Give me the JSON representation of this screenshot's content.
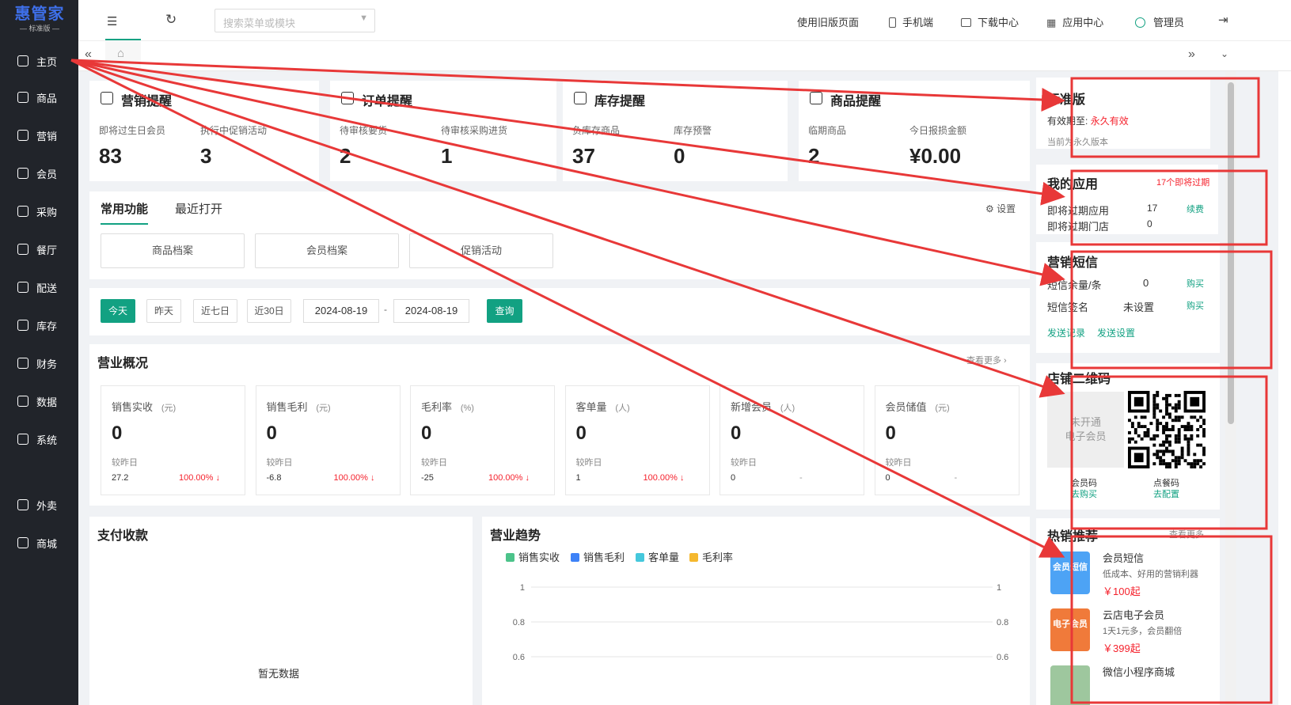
{
  "brand": {
    "name": "惠管家",
    "edition": "标准版"
  },
  "nav": [
    {
      "label": "主页",
      "icon": "home-icon"
    },
    {
      "label": "商品",
      "icon": "box-icon"
    },
    {
      "label": "营销",
      "icon": "chart-icon"
    },
    {
      "label": "会员",
      "icon": "diamond-icon"
    },
    {
      "label": "采购",
      "icon": "cart-icon"
    },
    {
      "label": "餐厅",
      "icon": "bell-icon"
    },
    {
      "label": "配送",
      "icon": "truck-icon"
    },
    {
      "label": "库存",
      "icon": "storage-icon"
    },
    {
      "label": "财务",
      "icon": "finance-icon"
    },
    {
      "label": "数据",
      "icon": "data-icon"
    },
    {
      "label": "系统",
      "icon": "settings-icon"
    },
    {
      "label": "外卖",
      "icon": "takeout-icon"
    },
    {
      "label": "商城",
      "icon": "mall-icon"
    }
  ],
  "topbar": {
    "search_placeholder": "搜索菜单或模块",
    "old_page": "使用旧版页面",
    "mobile": "手机端",
    "download": "下载中心",
    "apps": "应用中心",
    "user": "管理员"
  },
  "reminders": [
    {
      "title": "营销提醒",
      "items": [
        {
          "label": "即将过生日会员",
          "value": "83"
        },
        {
          "label": "执行中促销活动",
          "value": "3"
        }
      ]
    },
    {
      "title": "订单提醒",
      "items": [
        {
          "label": "待审核要货",
          "value": "2"
        },
        {
          "label": "待审核采购进货",
          "value": "1"
        }
      ]
    },
    {
      "title": "库存提醒",
      "items": [
        {
          "label": "负库存商品",
          "value": "37"
        },
        {
          "label": "库存预警",
          "value": "0"
        }
      ]
    },
    {
      "title": "商品提醒",
      "items": [
        {
          "label": "临期商品",
          "value": "2"
        },
        {
          "label": "今日报损金额",
          "value": "¥0.00"
        }
      ]
    }
  ],
  "functions": {
    "tab_active": "常用功能",
    "tab_other": "最近打开",
    "settings": "设置",
    "shortcuts": [
      "商品档案",
      "会员档案",
      "促销活动"
    ]
  },
  "filter": {
    "buttons": [
      "今天",
      "昨天",
      "近七日",
      "近30日"
    ],
    "start": "2024-08-19",
    "sep": "-",
    "end": "2024-08-19",
    "query": "查询"
  },
  "overview": {
    "title": "营业概况",
    "more": "查看更多",
    "metrics": [
      {
        "name": "销售实收",
        "unit": "(元)",
        "value": "0",
        "cmp": "较昨日",
        "prev": "27.2",
        "pct": "100.00% ↓"
      },
      {
        "name": "销售毛利",
        "unit": "(元)",
        "value": "0",
        "cmp": "较昨日",
        "prev": "-6.8",
        "pct": "100.00% ↓"
      },
      {
        "name": "毛利率",
        "unit": "(%)",
        "value": "0",
        "cmp": "较昨日",
        "prev": "-25",
        "pct": "100.00% ↓"
      },
      {
        "name": "客单量",
        "unit": "(人)",
        "value": "0",
        "cmp": "较昨日",
        "prev": "1",
        "pct": "100.00% ↓"
      },
      {
        "name": "新增会员",
        "unit": "(人)",
        "value": "0",
        "cmp": "较昨日",
        "prev": "0",
        "pct": "-"
      },
      {
        "name": "会员储值",
        "unit": "(元)",
        "value": "0",
        "cmp": "较昨日",
        "prev": "0",
        "pct": "-"
      }
    ]
  },
  "payment": {
    "title": "支付收款",
    "empty": "暂无数据"
  },
  "trend": {
    "title": "营业趋势"
  },
  "chart_data": {
    "type": "line",
    "title": "营业趋势",
    "series": [
      {
        "name": "销售实收",
        "color": "#4cc38a",
        "values": []
      },
      {
        "name": "销售毛利",
        "color": "#3e82f7",
        "values": []
      },
      {
        "name": "客单量",
        "color": "#45c8dc",
        "values": []
      },
      {
        "name": "毛利率",
        "color": "#f5b82e",
        "values": []
      }
    ],
    "yticks": [
      "1",
      "0.8",
      "0.6"
    ],
    "ylim": [
      0,
      1
    ]
  },
  "edition": {
    "title": "标准版",
    "validity_label": "有效期至:",
    "validity_value": "永久有效",
    "note": "当前为永久版本"
  },
  "myapps": {
    "title": "我的应用",
    "badge": "17个即将过期",
    "rows": [
      {
        "label": "即将过期应用",
        "value": "17",
        "action": "续费"
      },
      {
        "label": "即将过期门店",
        "value": "0",
        "action": ""
      }
    ]
  },
  "sms": {
    "title": "营销短信",
    "rows": [
      {
        "label": "短信余量/条",
        "value": "0",
        "action": "购买"
      },
      {
        "label": "短信签名",
        "value": "未设置",
        "action": "购买"
      }
    ],
    "links": [
      "发送记录",
      "发送设置"
    ]
  },
  "qrcode": {
    "title": "店铺二维码",
    "placeholder_l1": "未开通",
    "placeholder_l2": "电子会员",
    "left_label": "会员码",
    "left_action": "去购买",
    "right_label": "点餐码",
    "right_action": "去配置"
  },
  "hot": {
    "title": "热销推荐",
    "more": "查看更多",
    "items": [
      {
        "name": "会员短信",
        "desc": "低成本、好用的营销利器",
        "price": "￥100起",
        "thumb": "会员短信"
      },
      {
        "name": "云店电子会员",
        "desc": "1天1元多，会员翻倍",
        "price": "￥399起",
        "thumb": "电子会员"
      },
      {
        "name": "微信小程序商城",
        "desc": "",
        "price": "",
        "thumb": ""
      }
    ]
  }
}
